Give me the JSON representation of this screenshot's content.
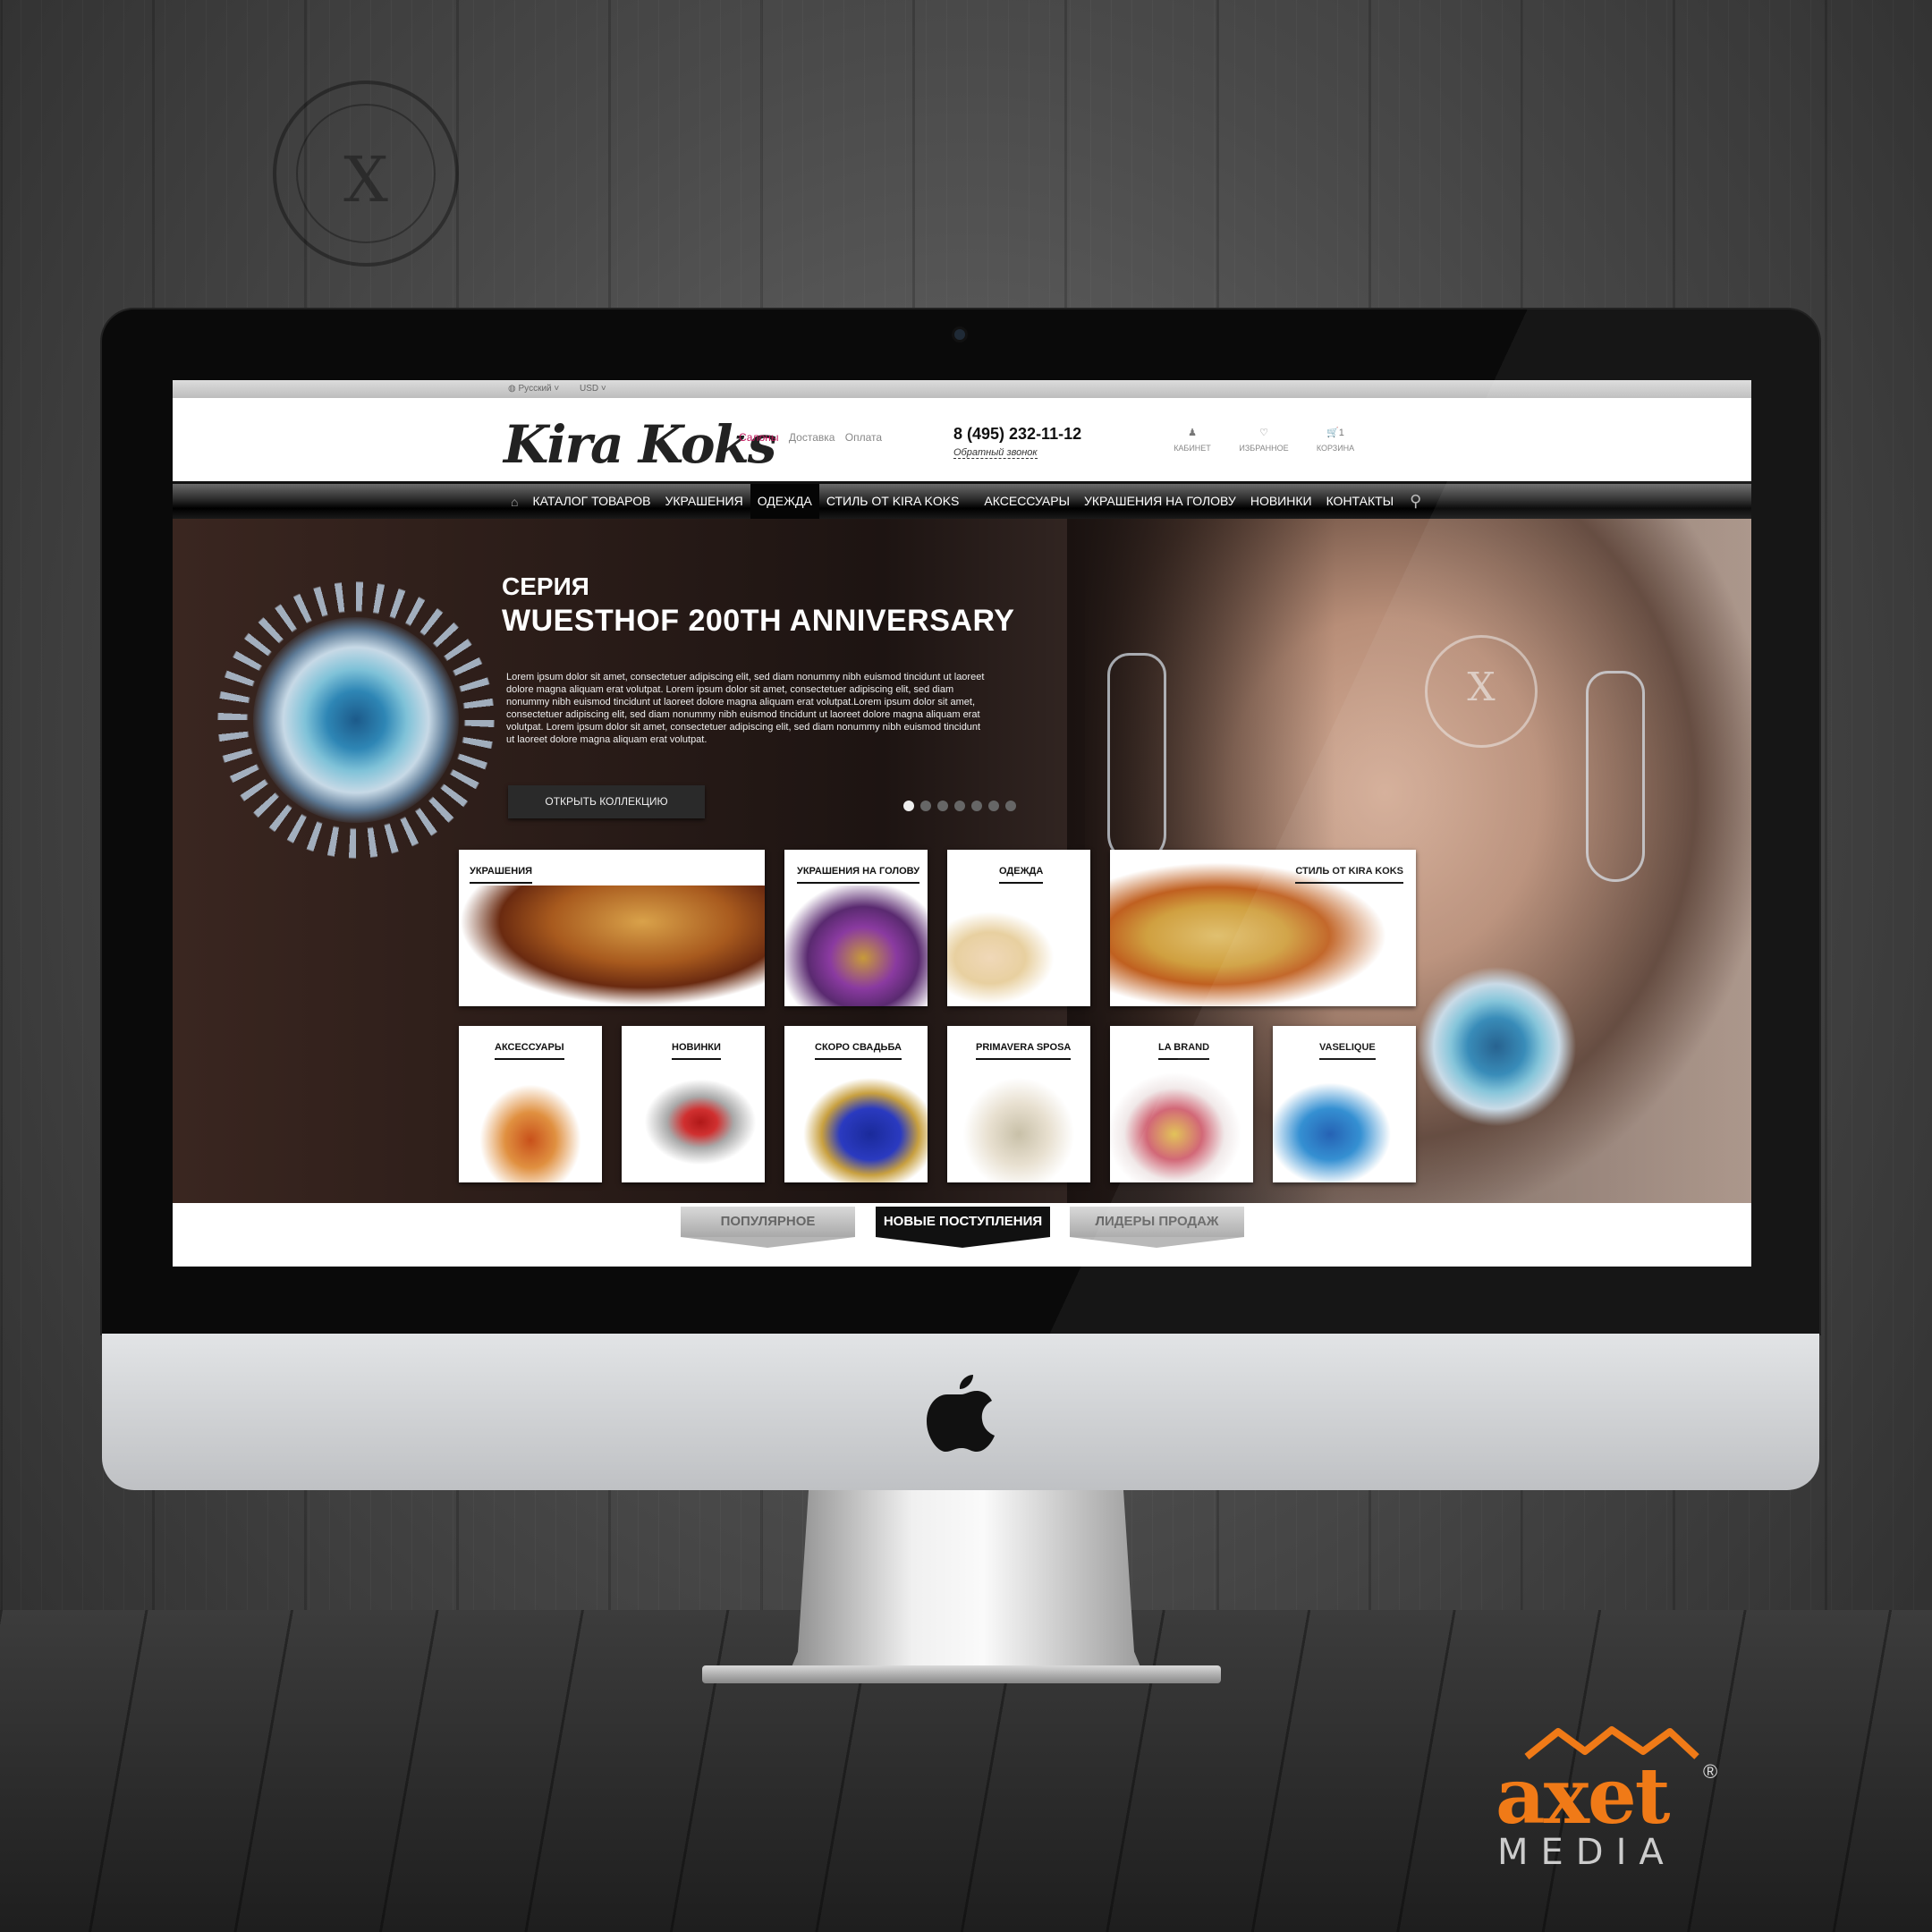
{
  "topbar": {
    "language": "Русский ˅",
    "currency": "USD ˅"
  },
  "header": {
    "logo_text": "Kira Koks",
    "links": [
      "Салоны",
      "Доставка",
      "Оплата"
    ],
    "phone": "8 (495) 232-11-12",
    "callback": "Обратный звонок",
    "icons": [
      {
        "icon": "user-icon",
        "label": "КАБИНЕТ"
      },
      {
        "icon": "heart-icon",
        "label": "ИЗБРАННОЕ"
      },
      {
        "icon": "cart-icon",
        "label": "КОРЗИНА",
        "count": "1"
      }
    ]
  },
  "nav": {
    "items": [
      "КАТАЛОГ ТОВАРОВ",
      "УКРАШЕНИЯ",
      "ОДЕЖДА",
      "СТИЛЬ ОТ KIRA KOKS",
      "АКСЕССУАРЫ",
      "УКРАШЕНИЯ НА ГОЛОВУ",
      "НОВИНКИ",
      "КОНТАКТЫ"
    ],
    "active_index": 2
  },
  "hero": {
    "title_line1": "СЕРИЯ",
    "title_line2": "WUESTHOF 200TH ANNIVERSARY",
    "text": "Lorem ipsum dolor sit amet, consectetuer adipiscing elit, sed diam nonummy nibh euismod tincidunt ut laoreet dolore magna aliquam erat volutpat. Lorem ipsum dolor sit amet, consectetuer adipiscing elit, sed diam nonummy nibh euismod tincidunt ut laoreet dolore magna aliquam erat volutpat.Lorem ipsum dolor sit amet, consectetuer adipiscing elit, sed diam nonummy nibh euismod tincidunt ut laoreet dolore magna aliquam erat volutpat. Lorem ipsum dolor sit amet, consectetuer adipiscing elit, sed diam nonummy nibh euismod tincidunt ut laoreet dolore magna aliquam erat volutpat.",
    "button": "ОТКРЫТЬ КОЛЛЕКЦИЮ",
    "slides": 7,
    "active_slide": 1
  },
  "categories": {
    "row1": [
      "УКРАШЕНИЯ",
      "УКРАШЕНИЯ НА ГОЛОВУ",
      "ОДЕЖДА",
      "СТИЛЬ ОТ KIRA KOKS"
    ],
    "row2": [
      "АКСЕССУАРЫ",
      "НОВИНКИ",
      "СКОРО СВАДЬБА",
      "PRIMAVERA SPOSA",
      "LA BRAND",
      "VASELIQUE"
    ]
  },
  "tabs": [
    "ПОПУЛЯРНОЕ",
    "НОВЫЕ ПОСТУПЛЕНИЯ",
    "ЛИДЕРЫ ПРОДАЖ"
  ],
  "active_tab": 1,
  "branding": {
    "axet": "axet",
    "media": "MEDIA"
  },
  "colors": {
    "accent": "#c3155c",
    "brand_orange": "#f07a17"
  }
}
